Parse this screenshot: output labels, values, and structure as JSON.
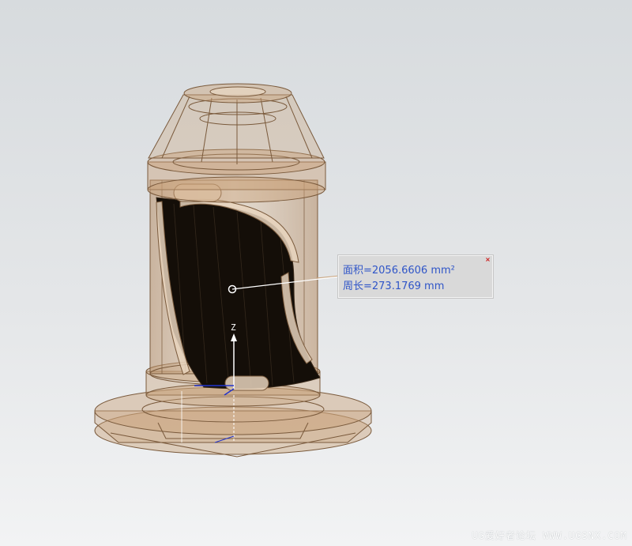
{
  "measurement": {
    "area_text": "面积=2056.6606 mm²",
    "perimeter_text": "周长=273.1769 mm",
    "close_glyph": "×",
    "text_color": "#2f55c8"
  },
  "axis": {
    "z_label": "Z",
    "color": "#ffffff"
  },
  "model": {
    "body_color": "#c9a27a",
    "edge_color": "#7a5a3c",
    "selected_face_color": "#140e08"
  },
  "watermark": {
    "text": "UG爱好者论坛 WWW.UGSNX.COM"
  }
}
